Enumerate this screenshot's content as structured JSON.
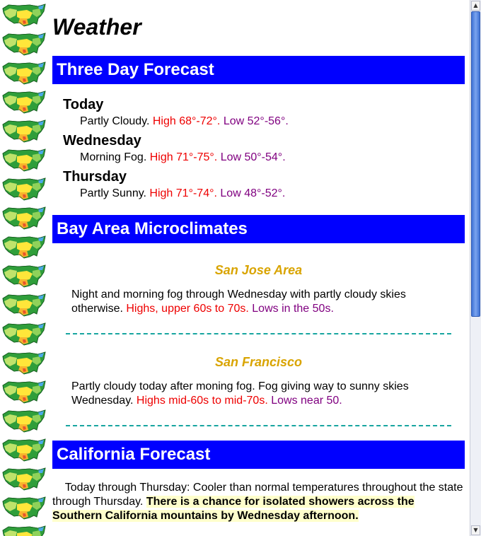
{
  "page": {
    "title": "Weather"
  },
  "sections": {
    "three_day": "Three Day Forecast",
    "microclimates": "Bay Area Microclimates",
    "california": "California Forecast"
  },
  "forecast": [
    {
      "day": "Today",
      "condition": "Partly Cloudy.",
      "high": "High 68°-72°.",
      "low": "Low 52°-56°."
    },
    {
      "day": "Wednesday",
      "condition": "Morning Fog.",
      "high": "High 71°-75°.",
      "low": "Low 50°-54°."
    },
    {
      "day": "Thursday",
      "condition": "Partly Sunny.",
      "high": "High 71°-74°.",
      "low": "Low 48°-52°."
    }
  ],
  "areas": [
    {
      "name": "San Jose Area",
      "text": "Night and morning fog through Wednesday with partly cloudy skies otherwise.",
      "highs": "Highs, upper 60s to 70s.",
      "lows": "Lows in the 50s."
    },
    {
      "name": "San Francisco",
      "text": "Partly cloudy today after moning fog. Fog giving way to sunny skies Wednesday.",
      "highs": "Highs mid-60s to mid-70s.",
      "lows": "Lows near 50."
    }
  ],
  "california": {
    "text": "Today through Thursday: Cooler than normal temperatures throughout the state through Thursday.",
    "highlight": "There is a chance for isolated showers across the Southern California mountains by Wednesday afternoon."
  },
  "icons": {
    "map_tile": "us-weather-map-icon",
    "scroll_up": "arrow-up-icon",
    "scroll_down": "arrow-down-icon"
  },
  "colors": {
    "header_bg": "#0000ff",
    "high_temp": "#ee0000",
    "low_temp": "#800080",
    "area_title": "#d9a400",
    "divider": "#17a5a0",
    "highlight_bg": "#ffffcc"
  }
}
